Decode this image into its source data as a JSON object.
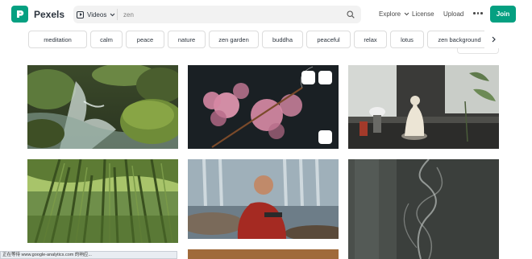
{
  "header": {
    "logo_text": "Pexels",
    "media_type": "Videos",
    "search_value": "zen",
    "nav": [
      "Explore",
      "License",
      "Upload"
    ],
    "join_label": "Join",
    "brand_color": "#05a081"
  },
  "tags": [
    "meditation",
    "calm",
    "peace",
    "nature",
    "zen garden",
    "buddha",
    "peaceful",
    "relax",
    "lotus",
    "zen background"
  ],
  "icons": [
    "search-icon",
    "chevron-down-icon",
    "play-icon",
    "more-icon",
    "chevron-right-icon"
  ],
  "results": [
    {
      "subject": "stream over mossy rocks"
    },
    {
      "subject": "incense and pink blossoms"
    },
    {
      "subject": "buddha statue by window"
    },
    {
      "subject": "bamboo forest canopy"
    },
    {
      "subject": "monk by waterfall"
    },
    {
      "subject": "incense smoke"
    }
  ],
  "status_text": "正在等待 www.google-analytics.com 的响应..."
}
